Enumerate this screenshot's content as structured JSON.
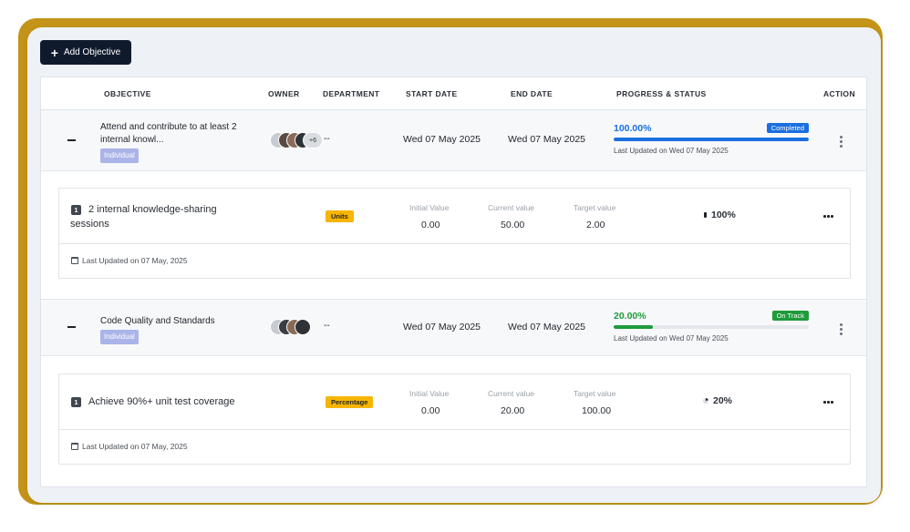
{
  "toolbar": {
    "add_label": "Add Objective"
  },
  "columns": {
    "objective": "OBJECTIVE",
    "owner": "OWNER",
    "department": "DEPARTMENT",
    "start_date": "START DATE",
    "end_date": "END DATE",
    "progress": "PROGRESS & STATUS",
    "action": "ACTION"
  },
  "objectives": [
    {
      "title": "Attend and contribute to at least 2 internal knowl...",
      "tag": "Individual",
      "owners_more": "+6",
      "department": "--",
      "start_date": "Wed 07 May 2025",
      "end_date": "Wed 07 May 2025",
      "progress_text": "100.00%",
      "progress_value": 100,
      "status": "Completed",
      "status_color": "#1a6fe0",
      "updated": "Last Updated on Wed 07 May 2025",
      "key_result": {
        "number": "1",
        "title": "2 internal knowledge-sharing sessions",
        "unit": "Units",
        "initial_label": "Initial Value",
        "initial": "0.00",
        "current_label": "Current value",
        "current": "50.00",
        "target_label": "Target value",
        "target": "2.00",
        "progress": "100%",
        "updated": "Last Updated on 07 May, 2025"
      }
    },
    {
      "title": "Code Quality and Standards",
      "tag": "Individual",
      "owners_more": "",
      "department": "--",
      "start_date": "Wed 07 May 2025",
      "end_date": "Wed 07 May 2025",
      "progress_text": "20.00%",
      "progress_value": 20,
      "status": "On Track",
      "status_color": "#1e9b3a",
      "updated": "Last Updated on Wed 07 May 2025",
      "key_result": {
        "number": "1",
        "title": "Achieve 90%+ unit test coverage",
        "unit": "Percentage",
        "initial_label": "Initial Value",
        "initial": "0.00",
        "current_label": "Current value",
        "current": "20.00",
        "target_label": "Target value",
        "target": "100.00",
        "progress": "20%",
        "updated": "Last Updated on 07 May, 2025"
      }
    }
  ]
}
